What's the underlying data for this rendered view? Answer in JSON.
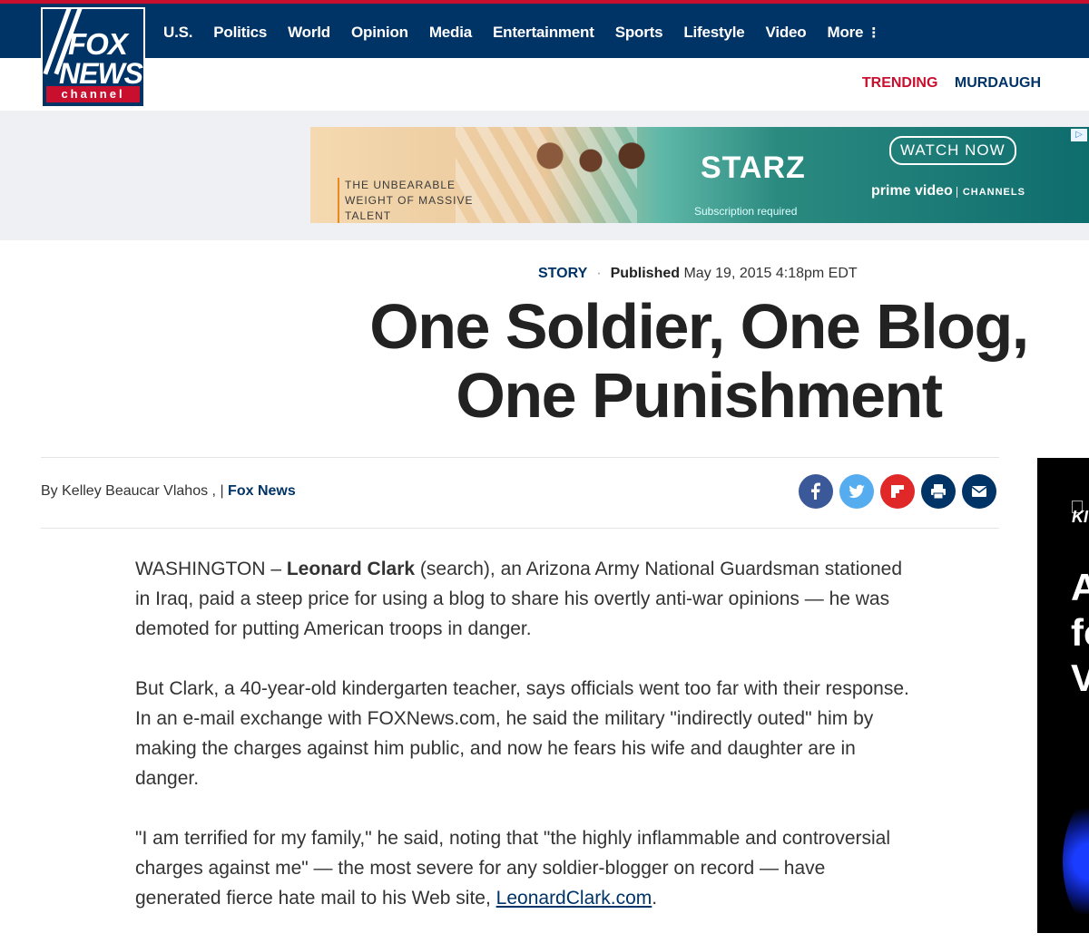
{
  "nav": {
    "items": [
      "U.S.",
      "Politics",
      "World",
      "Opinion",
      "Media",
      "Entertainment",
      "Sports",
      "Lifestyle",
      "Video",
      "More"
    ]
  },
  "logo": {
    "fox": "FOX",
    "news": "NEWS",
    "channel": "channel"
  },
  "trending": {
    "label": "TRENDING",
    "topic": "MURDAUGH"
  },
  "ad": {
    "movie": [
      "THE UNBEARABLE",
      "WEIGHT OF MASSIVE",
      "TALENT"
    ],
    "brand": "STARZ",
    "sub": "Subscription required",
    "cta": "WATCH NOW",
    "prime": "prime video",
    "channels": "CHANNELS",
    "choice": "▷"
  },
  "article": {
    "type": "STORY",
    "published_label": "Published",
    "published_date": "May 19, 2015 4:18pm EDT",
    "headline": "One Soldier, One Blog, One Punishment",
    "byline": "By Kelley Beaucar Vlahos , |",
    "source": "Fox News",
    "p1_a": "WASHINGTON – ",
    "p1_name": "Leonard Clark",
    "p1_b": " (search), an Arizona Army National Guardsman stationed in Iraq, paid a steep price for using a blog to share his overtly anti-war opinions — he was demoted for putting American troops in danger.",
    "p2": "But Clark, a 40-year-old kindergarten teacher, says officials went too far with their response. In an e-mail exchange with FOXNews.com, he said the military \"indirectly outed\" him by making the charges against him public, and now he fears his wife and daughter are in danger.",
    "p3_a": "\"I am terrified for my family,\" he said, noting that \"the highly inflammable and controversial charges against me\" — the most severe for any soldier-blogger on record — have generated fierce hate mail to his Web site, ",
    "p3_link": "LeonardClark.com",
    "p3_b": "."
  },
  "share": [
    {
      "name": "facebook",
      "color": "#3b5998"
    },
    {
      "name": "twitter",
      "color": "#55acee"
    },
    {
      "name": "flipboard",
      "color": "#e12828"
    },
    {
      "name": "print",
      "color": "#003366"
    },
    {
      "name": "email",
      "color": "#003366"
    }
  ],
  "side_ad": {
    "k": "KI",
    "big": [
      "A",
      "fo",
      "V("
    ]
  }
}
